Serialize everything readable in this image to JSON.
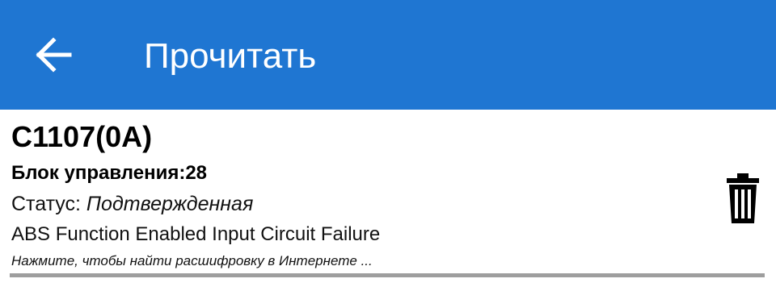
{
  "app_bar": {
    "title": "Прочитать",
    "background_color": "#1f76d2",
    "back_icon": "arrow-left-icon"
  },
  "dtc": {
    "code": "C1107(0A)",
    "ecu_label": "Блок управления:28",
    "status_label": "Статус: ",
    "status_value": "Подтвержденная",
    "description": "ABS Function Enabled Input Circuit Failure",
    "hint": "Нажмите, чтобы найти расшифровку в Интернете ...",
    "delete_icon": "trash-icon"
  }
}
